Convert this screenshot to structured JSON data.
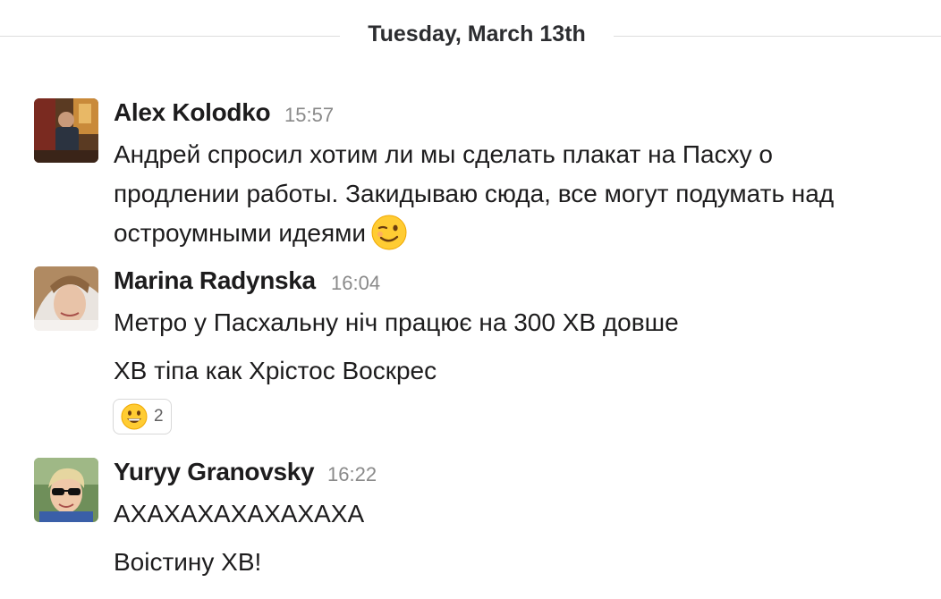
{
  "day_divider": {
    "label": "Tuesday, March 13th"
  },
  "messages": [
    {
      "sender": "Alex Kolodko",
      "time": "15:57",
      "lines": [
        "Андрей спросил хотим ли мы сделать плакат на Пасху о",
        "продлении работы. Закидываю сюда, все могут подумать над",
        "остроумными идеями"
      ],
      "inline_emoji": "winking-face"
    },
    {
      "sender": "Marina Radynska",
      "time": "16:04",
      "lines": [
        "Метро у Пасхальну ніч працює на 300 ХВ довше",
        "ХВ тіпа как Хрістос Воскрес"
      ],
      "reaction": {
        "emoji": "grinning-face",
        "count": "2"
      }
    },
    {
      "sender": "Yuryy Granovsky",
      "time": "16:22",
      "lines": [
        "АХАХАХАХАХАХАХА",
        "Воістину ХВ!"
      ]
    }
  ],
  "colors": {
    "text": "#1d1c1d",
    "timestamp": "#8a8a8a",
    "divider": "#dddddd",
    "emoji_yellow": "#ffcc33"
  }
}
